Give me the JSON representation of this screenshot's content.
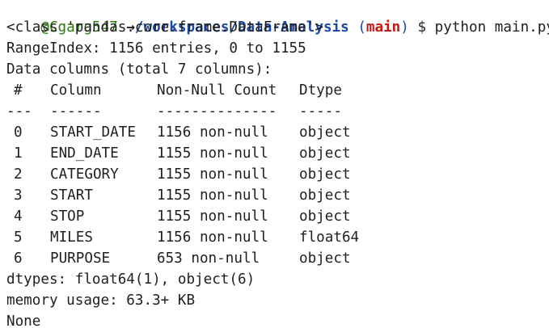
{
  "prompt": {
    "user": "@Cgarg547",
    "arrow": "→",
    "path": "/workspaces/Data-Analysis",
    "branch_open": "(",
    "branch": "main",
    "branch_close": ")",
    "dollar": "$",
    "command": "python main.py"
  },
  "info": {
    "class_line": "<class 'pandas.core.frame.DataFrame'>",
    "range_index": "RangeIndex: 1156 entries, 0 to 1155",
    "data_columns": "Data columns (total 7 columns):"
  },
  "table": {
    "headers": {
      "index": "#",
      "column": "Column",
      "non_null": "Non-Null Count",
      "dtype": "Dtype"
    },
    "separators": {
      "index": "---",
      "column": "------",
      "non_null": "--------------",
      "dtype": "-----"
    },
    "rows": [
      {
        "index": "0",
        "column": "START_DATE",
        "non_null": "1156 non-null",
        "dtype": "object"
      },
      {
        "index": "1",
        "column": "END_DATE",
        "non_null": "1155 non-null",
        "dtype": "object"
      },
      {
        "index": "2",
        "column": "CATEGORY",
        "non_null": "1155 non-null",
        "dtype": "object"
      },
      {
        "index": "3",
        "column": "START",
        "non_null": "1155 non-null",
        "dtype": "object"
      },
      {
        "index": "4",
        "column": "STOP",
        "non_null": "1155 non-null",
        "dtype": "object"
      },
      {
        "index": "5",
        "column": "MILES",
        "non_null": "1156 non-null",
        "dtype": "float64"
      },
      {
        "index": "6",
        "column": "PURPOSE",
        "non_null": "653 non-null",
        "dtype": "object"
      }
    ]
  },
  "footer": {
    "dtypes": "dtypes: float64(1), object(6)",
    "memory": "memory usage: 63.3+ KB",
    "none": "None"
  }
}
